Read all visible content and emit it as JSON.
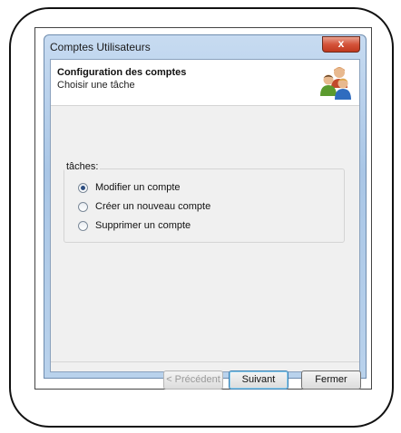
{
  "window": {
    "title": "Comptes Utilisateurs",
    "close_glyph": "x"
  },
  "header": {
    "title": "Configuration des comptes",
    "subtitle": "Choisir une tâche",
    "icon": "users-icon"
  },
  "tasks": {
    "legend": "tâches:",
    "options": [
      {
        "label": "Modifier un compte",
        "checked": true
      },
      {
        "label": "Créer un nouveau compte",
        "checked": false
      },
      {
        "label": "Supprimer un compte",
        "checked": false
      }
    ]
  },
  "buttons": {
    "previous": "< Précédent",
    "next": "Suivant",
    "close": "Fermer"
  }
}
